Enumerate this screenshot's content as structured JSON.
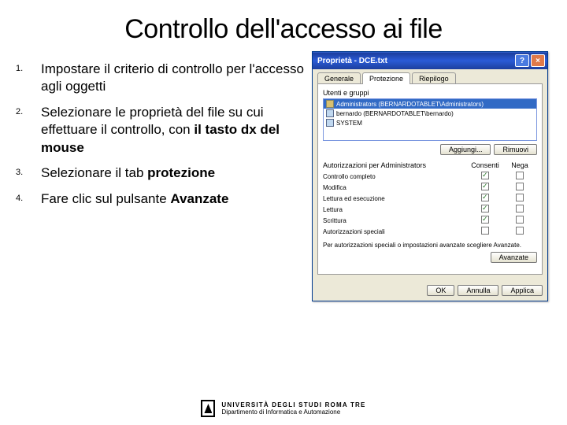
{
  "slide": {
    "title": "Controllo dell'accesso ai file",
    "steps": [
      {
        "html": "Impostare il criterio di controllo per l'accesso agli oggetti"
      },
      {
        "html": "Selezionare le proprietà del file su cui effettuare il controllo, con <b>il tasto dx del mouse</b>"
      },
      {
        "html": "Selezionare il tab <b>protezione</b>"
      },
      {
        "html": "Fare clic sul pulsante <b>Avanzate</b>"
      }
    ]
  },
  "dialog": {
    "title": "Proprietà - DCE.txt",
    "tabs": [
      "Generale",
      "Protezione",
      "Riepilogo"
    ],
    "activeTab": 1,
    "groupLabel": "Utenti e gruppi",
    "users": [
      {
        "name": "Administrators (BERNARDOTABLET\\Administrators)",
        "selected": true
      },
      {
        "name": "bernardo (BERNARDOTABLET\\bernardo)"
      },
      {
        "name": "SYSTEM"
      }
    ],
    "addBtn": "Aggiungi...",
    "removeBtn": "Rimuovi",
    "permHeader": {
      "name": "Autorizzazioni per Administrators",
      "allow": "Consenti",
      "deny": "Nega"
    },
    "perms": [
      {
        "name": "Controllo completo",
        "allow": true,
        "deny": false
      },
      {
        "name": "Modifica",
        "allow": true,
        "deny": false
      },
      {
        "name": "Lettura ed esecuzione",
        "allow": true,
        "deny": false
      },
      {
        "name": "Lettura",
        "allow": true,
        "deny": false
      },
      {
        "name": "Scrittura",
        "allow": true,
        "deny": false
      },
      {
        "name": "Autorizzazioni speciali",
        "allow": false,
        "deny": false
      }
    ],
    "advText": "Per autorizzazioni speciali o impostazioni avanzate scegliere Avanzate.",
    "advBtn": "Avanzate",
    "ok": "OK",
    "cancel": "Annulla",
    "apply": "Applica"
  },
  "footer": {
    "line1": "UNIVERSITÀ DEGLI STUDI ROMA TRE",
    "line2": "Dipartimento di Informatica e Automazione"
  }
}
